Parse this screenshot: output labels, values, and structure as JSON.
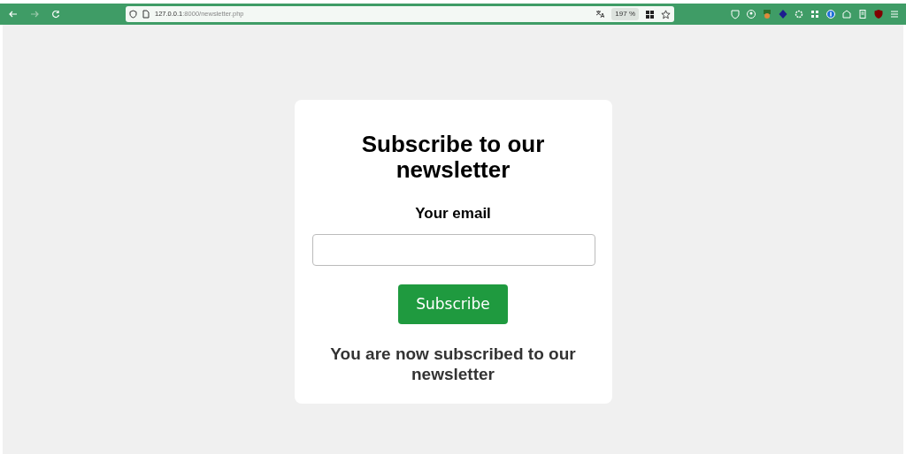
{
  "browser": {
    "url_host": "127.0.0.1",
    "url_rest": ":8000/newsletter.php",
    "zoom": "197 %"
  },
  "form": {
    "title": "Subscribe to our newsletter",
    "label": "Your email",
    "button": "Subscribe",
    "message": "You are now subscribed to our newsletter"
  }
}
